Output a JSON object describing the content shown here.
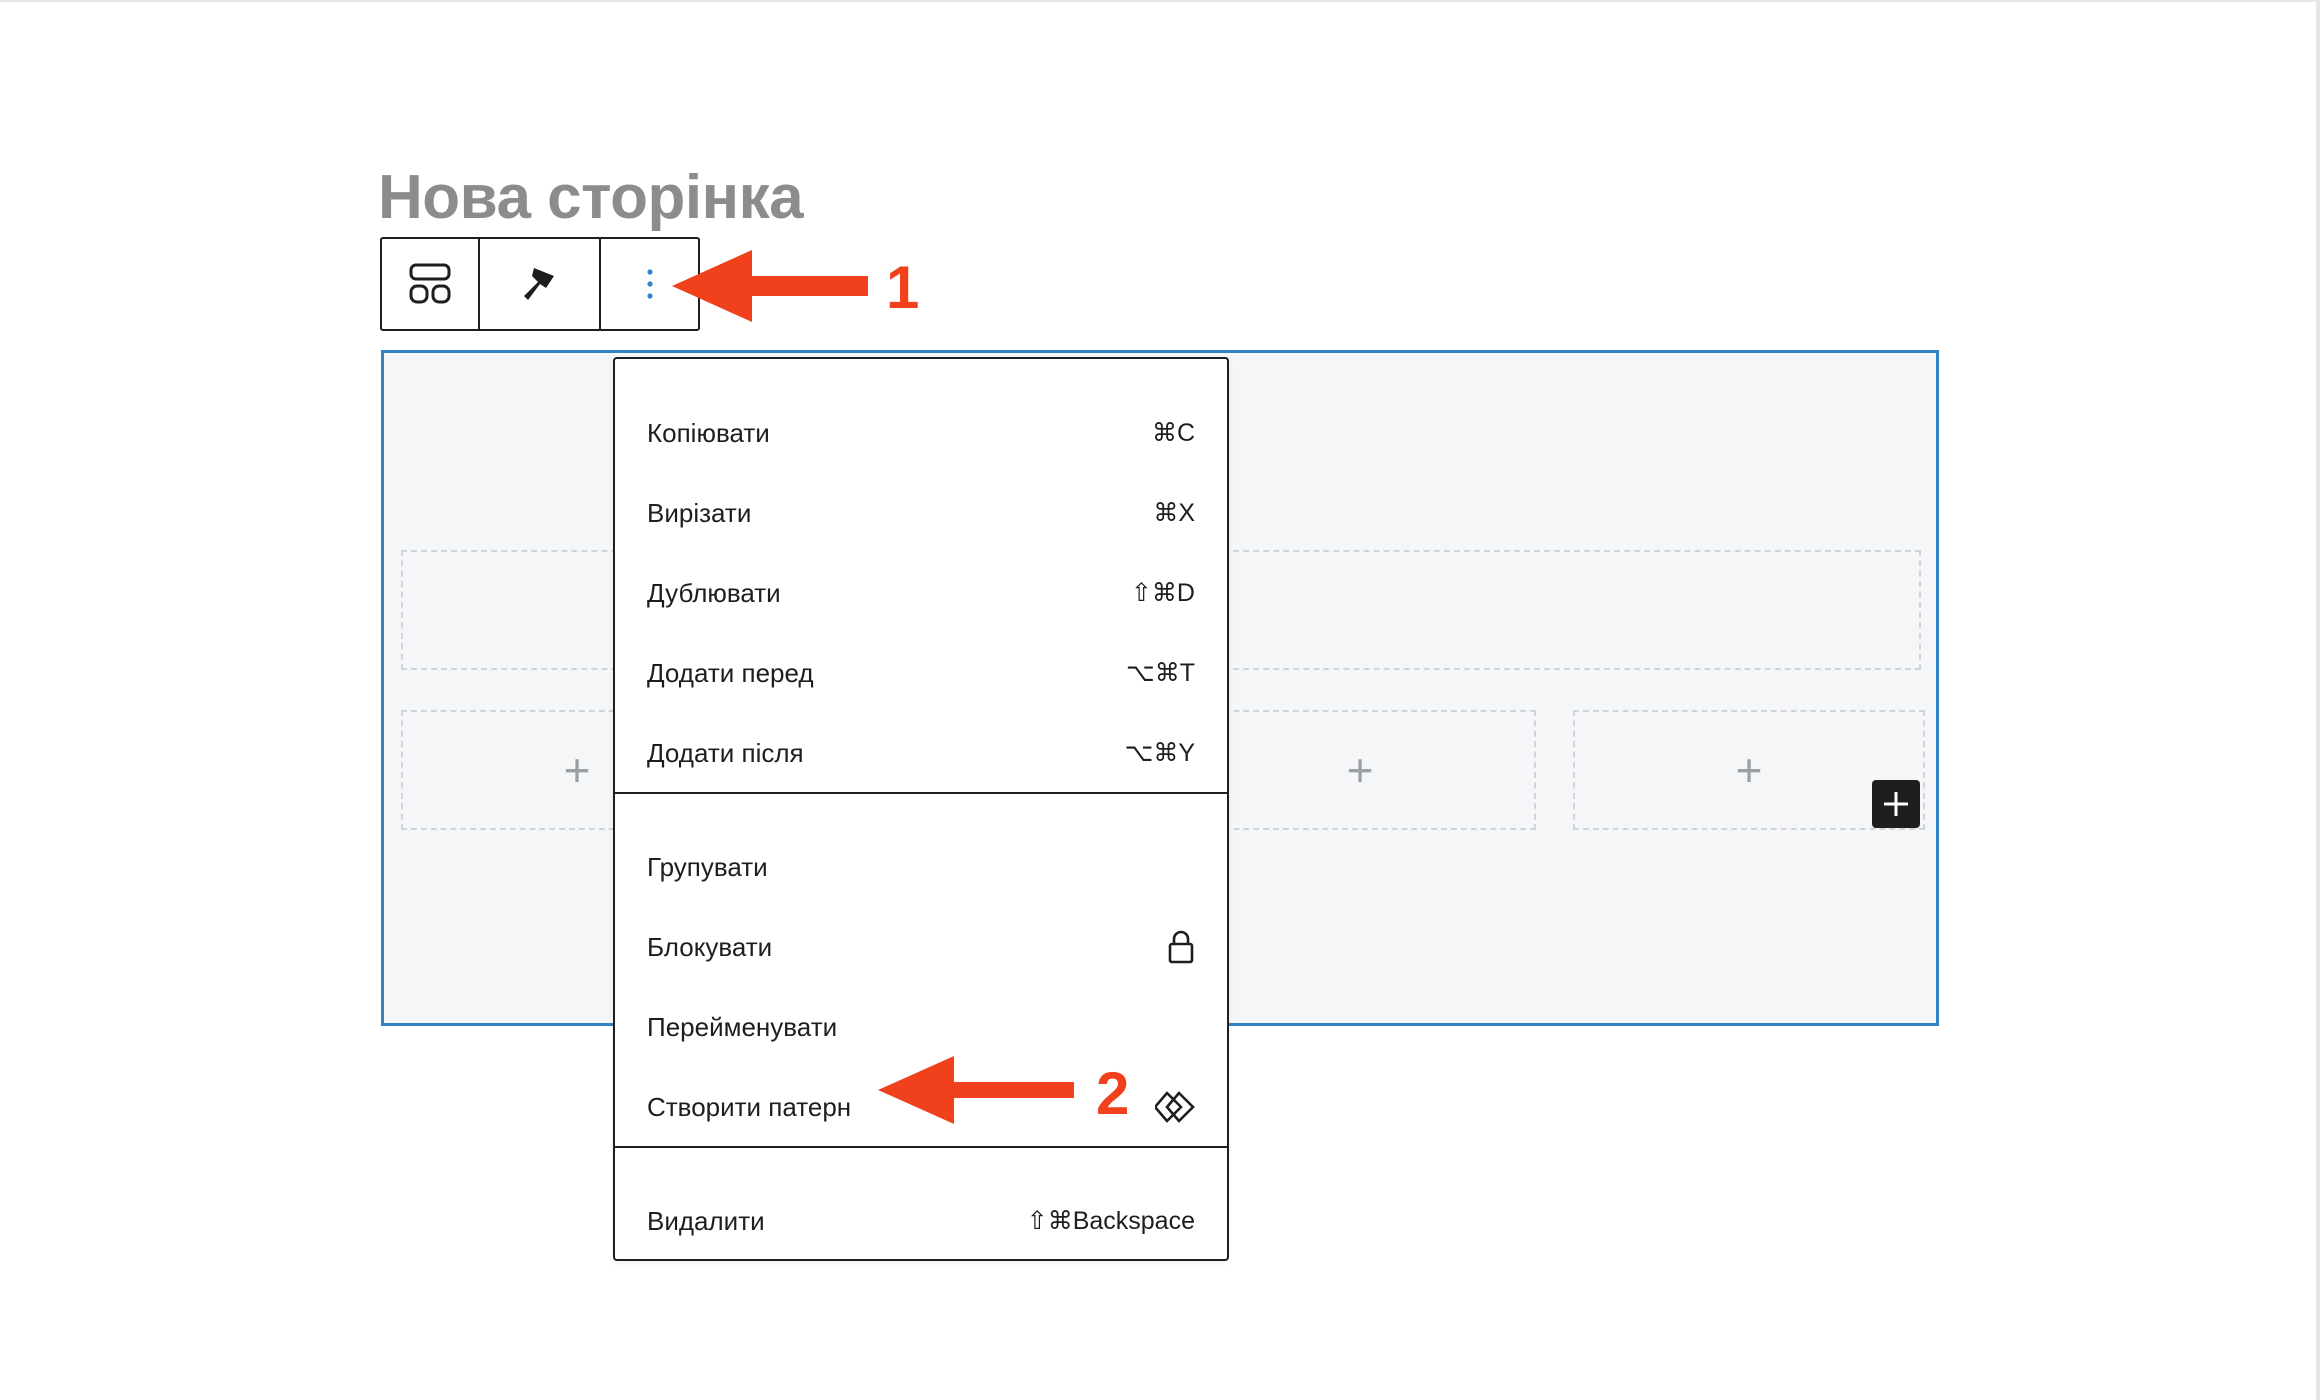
{
  "page": {
    "title": "Нова сторінка"
  },
  "toolbar": {
    "buttons": [
      {
        "icon": "layout-grid-icon"
      },
      {
        "icon": "brush-icon"
      },
      {
        "icon": "vertical-ellipsis-icon"
      }
    ]
  },
  "menu": {
    "section1": [
      {
        "label": "Копіювати",
        "shortcut": "⌘C"
      },
      {
        "label": "Вирізати",
        "shortcut": "⌘X"
      },
      {
        "label": "Дублювати",
        "shortcut": "⇧⌘D"
      },
      {
        "label": "Додати перед",
        "shortcut": "⌥⌘T"
      },
      {
        "label": "Додати після",
        "shortcut": "⌥⌘Y"
      }
    ],
    "section2": [
      {
        "label": "Групувати",
        "icon": ""
      },
      {
        "label": "Блокувати",
        "icon": "lock-icon"
      },
      {
        "label": "Перейменувати",
        "icon": ""
      },
      {
        "label": "Створити патерн",
        "icon": "pattern-icon"
      }
    ],
    "section3": [
      {
        "label": "Видалити",
        "shortcut": "⇧⌘Backspace"
      }
    ]
  },
  "annotations": {
    "step1": "1",
    "step2": "2",
    "arrow_color": "#f0401c"
  },
  "colors": {
    "accent": "#3582c4",
    "canvas_bg": "#f5f6f8",
    "title_gray": "#8c8c8c"
  }
}
